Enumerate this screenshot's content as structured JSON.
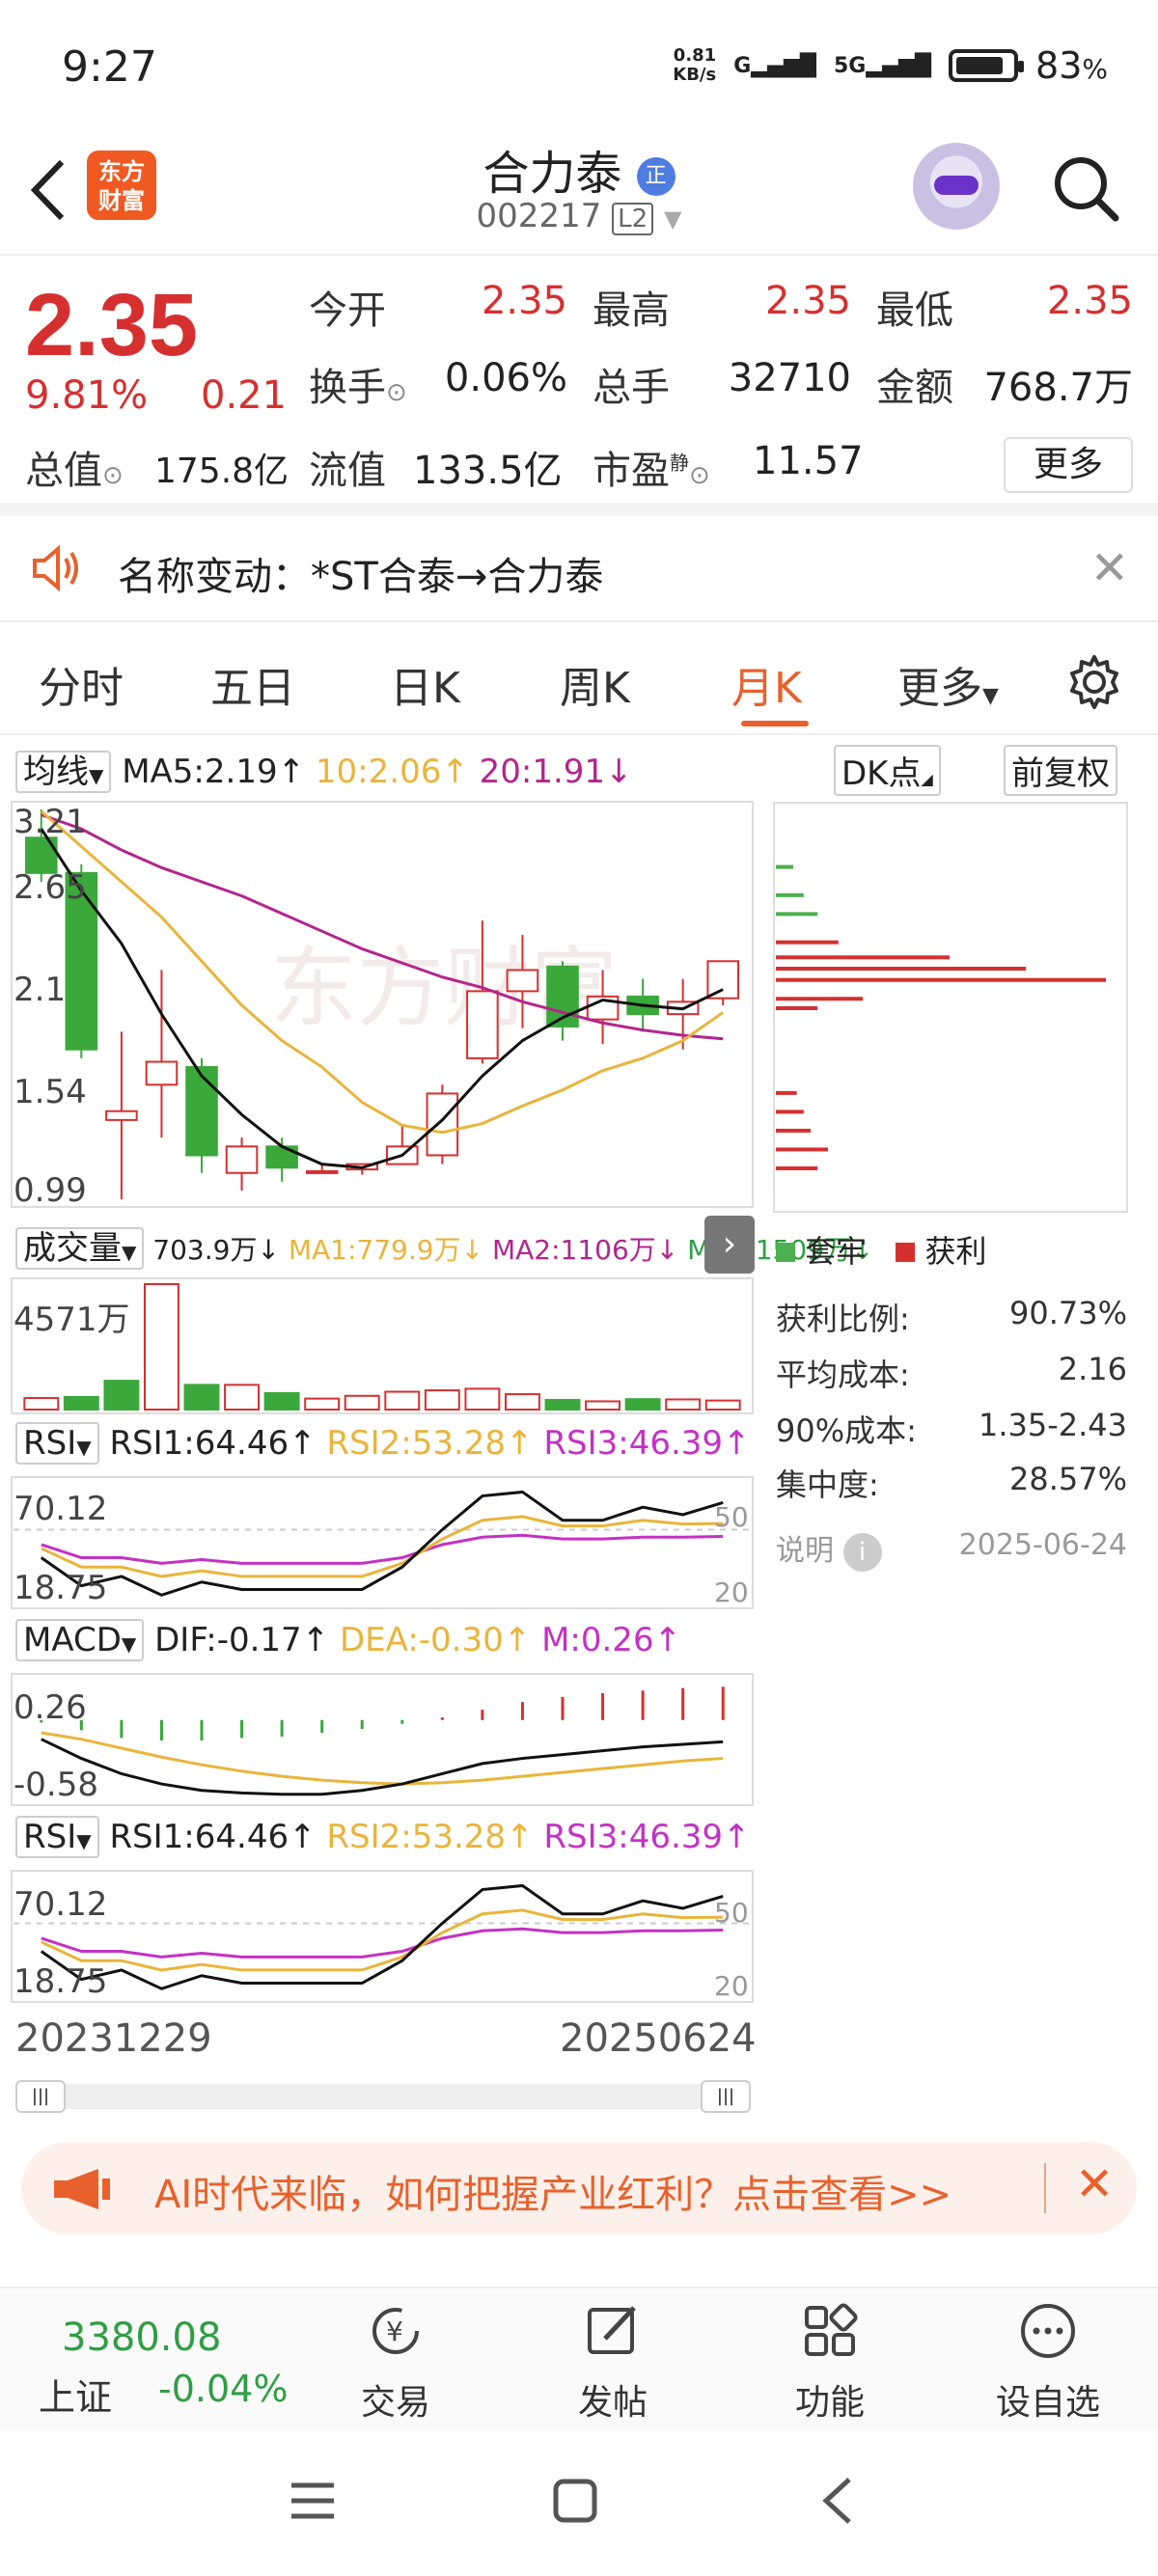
{
  "status": {
    "time": "9:27",
    "netspeed": "0.81\nKB/s",
    "signal_g": "G",
    "signal_5g": "5G",
    "battery": "83",
    "battery_unit": "%",
    "battery_level": 0.83
  },
  "header": {
    "back_icon": "chevron-left-icon",
    "logo_line1": "东方",
    "logo_line2": "财富",
    "stock_name": "合力泰",
    "name_tag": "正",
    "stock_code": "002217",
    "l2_tag": "L2"
  },
  "quote": {
    "price": "2.35",
    "pct_change": "9.81%",
    "change": "0.21",
    "open_label": "今开",
    "open": "2.35",
    "high_label": "最高",
    "high": "2.35",
    "low_label": "最低",
    "low": "2.35",
    "turnover_label": "换手",
    "turnover": "0.06%",
    "volume_label": "总手",
    "volume": "32710",
    "amount_label": "金额",
    "amount": "768.7万",
    "mktcap_label": "总值",
    "mktcap": "175.8亿",
    "float_label": "流值",
    "float": "133.5亿",
    "pe_label": "市盈",
    "pe_sup": "静",
    "pe": "11.57",
    "more": "更多"
  },
  "notice": {
    "text": "名称变动：*ST合泰→合力泰"
  },
  "tabs": [
    "分时",
    "五日",
    "日K",
    "周K",
    "月K",
    "更多"
  ],
  "active_tab": 4,
  "ma_row": {
    "selector": "均线",
    "ma5": "MA5:2.19",
    "ma10": "10:2.06",
    "ma20": "20:1.91",
    "dk": "DK点",
    "adjust": "前复权"
  },
  "vol_row": {
    "selector": "成交量",
    "v": "703.9万",
    "ma1": "MA1:779.9万",
    "ma2": "MA2:1106万",
    "ma3": "MA3:1509万",
    "max_label": "4571万"
  },
  "rsi_row": {
    "selector": "RSI",
    "rsi1": "RSI1:64.46",
    "rsi2": "RSI2:53.28",
    "rsi3": "RSI3:46.39",
    "top": "70.12",
    "bottom": "18.75",
    "r50": "50",
    "r20": "20"
  },
  "macd_row": {
    "selector": "MACD",
    "dif": "DIF:-0.17",
    "dea": "DEA:-0.30",
    "m": "M:0.26",
    "top": "0.26",
    "bottom": "-0.58"
  },
  "dates": {
    "start": "20231229",
    "end": "20250624"
  },
  "chips": {
    "legend_trap": "套牢",
    "legend_profit": "获利",
    "rows": [
      {
        "label": "获利比例:",
        "value": "90.73%"
      },
      {
        "label": "平均成本:",
        "value": "2.16"
      },
      {
        "label": "90%成本:",
        "value": "1.35-2.43"
      },
      {
        "label": "集中度:",
        "value": "28.57%"
      }
    ],
    "note_label": "说明",
    "note_date": "2025-06-24"
  },
  "banner": {
    "text": "AI时代来临，如何把握产业红利？点击查看>>"
  },
  "bottom": {
    "index_value": "3380.08",
    "index_name": "上证",
    "index_change": "-0.04%",
    "items": [
      "交易",
      "发帖",
      "功能",
      "设自选"
    ]
  },
  "chart_data": {
    "type": "candlestick",
    "title": "合力泰 月K",
    "y_ticks": [
      3.21,
      2.65,
      2.1,
      1.54,
      0.99
    ],
    "ylim": [
      0.99,
      3.21
    ],
    "candles": [
      {
        "o": 3.05,
        "c": 2.85,
        "h": 3.21,
        "l": 2.8
      },
      {
        "o": 2.85,
        "c": 1.85,
        "h": 2.9,
        "l": 1.8
      },
      {
        "o": 1.45,
        "c": 1.5,
        "h": 1.95,
        "l": 1.0
      },
      {
        "o": 1.65,
        "c": 1.78,
        "h": 2.3,
        "l": 1.35
      },
      {
        "o": 1.75,
        "c": 1.25,
        "h": 1.8,
        "l": 1.15
      },
      {
        "o": 1.15,
        "c": 1.3,
        "h": 1.35,
        "l": 1.05
      },
      {
        "o": 1.3,
        "c": 1.18,
        "h": 1.35,
        "l": 1.1
      },
      {
        "o": 1.15,
        "c": 1.16,
        "h": 1.2,
        "l": 1.15
      },
      {
        "o": 1.17,
        "c": 1.2,
        "h": 1.2,
        "l": 1.14
      },
      {
        "o": 1.2,
        "c": 1.3,
        "h": 1.42,
        "l": 1.2
      },
      {
        "o": 1.25,
        "c": 1.6,
        "h": 1.65,
        "l": 1.2
      },
      {
        "o": 1.8,
        "c": 2.18,
        "h": 2.58,
        "l": 1.77
      },
      {
        "o": 2.18,
        "c": 2.3,
        "h": 2.5,
        "l": 1.97
      },
      {
        "o": 2.32,
        "c": 1.98,
        "h": 2.35,
        "l": 1.9
      },
      {
        "o": 2.02,
        "c": 2.15,
        "h": 2.3,
        "l": 1.88
      },
      {
        "o": 2.15,
        "c": 2.05,
        "h": 2.25,
        "l": 1.95
      },
      {
        "o": 2.05,
        "c": 2.12,
        "h": 2.25,
        "l": 1.85
      },
      {
        "o": 2.14,
        "c": 2.35,
        "h": 2.35,
        "l": 2.1
      }
    ],
    "ma5": [
      3.1,
      2.75,
      2.45,
      2.05,
      1.7,
      1.48,
      1.3,
      1.2,
      1.18,
      1.25,
      1.45,
      1.7,
      1.9,
      2.03,
      2.13,
      2.1,
      2.08,
      2.19
    ],
    "ma10": [
      3.2,
      3.0,
      2.8,
      2.6,
      2.35,
      2.1,
      1.9,
      1.75,
      1.55,
      1.42,
      1.38,
      1.43,
      1.53,
      1.62,
      1.73,
      1.8,
      1.9,
      2.06
    ],
    "ma20": [
      3.18,
      3.1,
      2.98,
      2.88,
      2.8,
      2.72,
      2.62,
      2.52,
      2.42,
      2.34,
      2.26,
      2.2,
      2.12,
      2.06,
      2.0,
      1.96,
      1.93,
      1.91
    ],
    "volume": [
      420,
      460,
      1050,
      4571,
      900,
      900,
      600,
      400,
      500,
      650,
      700,
      760,
      560,
      350,
      300,
      380,
      370,
      330
    ],
    "volume_up": [
      true,
      false,
      false,
      true,
      false,
      true,
      false,
      true,
      true,
      true,
      true,
      true,
      true,
      false,
      true,
      false,
      true,
      true
    ],
    "rsi1": [
      35,
      20,
      25,
      15,
      22,
      18,
      18,
      18,
      18,
      30,
      50,
      68,
      70.12,
      55,
      55,
      62,
      58,
      64.46
    ],
    "rsi2": [
      40,
      30,
      30,
      25,
      28,
      25,
      25,
      25,
      25,
      32,
      45,
      55,
      57,
      52,
      52,
      55,
      53,
      53.28
    ],
    "rsi3": [
      42,
      35,
      35,
      32,
      34,
      32,
      32,
      32,
      32,
      35,
      42,
      46,
      47,
      45,
      45,
      46,
      46,
      46.39
    ],
    "macd_m": [
      -0.02,
      -0.08,
      -0.14,
      -0.16,
      -0.16,
      -0.14,
      -0.13,
      -0.1,
      -0.07,
      -0.03,
      0.02,
      0.08,
      0.14,
      0.18,
      0.21,
      0.23,
      0.25,
      0.26
    ],
    "dif": [
      -0.15,
      -0.3,
      -0.42,
      -0.5,
      -0.55,
      -0.57,
      -0.58,
      -0.58,
      -0.55,
      -0.5,
      -0.42,
      -0.34,
      -0.3,
      -0.27,
      -0.24,
      -0.21,
      -0.19,
      -0.17
    ],
    "dea": [
      -0.1,
      -0.15,
      -0.22,
      -0.29,
      -0.35,
      -0.4,
      -0.44,
      -0.47,
      -0.49,
      -0.5,
      -0.49,
      -0.47,
      -0.44,
      -0.41,
      -0.38,
      -0.35,
      -0.32,
      -0.3
    ],
    "chips": [
      {
        "price": 2.7,
        "w": 0.05,
        "type": "trap"
      },
      {
        "price": 2.55,
        "w": 0.08,
        "type": "trap"
      },
      {
        "price": 2.45,
        "w": 0.12,
        "type": "trap"
      },
      {
        "price": 2.3,
        "w": 0.18,
        "type": "profit"
      },
      {
        "price": 2.22,
        "w": 0.5,
        "type": "profit"
      },
      {
        "price": 2.16,
        "w": 0.72,
        "type": "profit"
      },
      {
        "price": 2.1,
        "w": 0.95,
        "type": "profit"
      },
      {
        "price": 2.0,
        "w": 0.25,
        "type": "profit"
      },
      {
        "price": 1.95,
        "w": 0.12,
        "type": "profit"
      },
      {
        "price": 1.5,
        "w": 0.06,
        "type": "profit"
      },
      {
        "price": 1.4,
        "w": 0.08,
        "type": "profit"
      },
      {
        "price": 1.3,
        "w": 0.1,
        "type": "profit"
      },
      {
        "price": 1.2,
        "w": 0.15,
        "type": "profit"
      },
      {
        "price": 1.1,
        "w": 0.12,
        "type": "profit"
      }
    ]
  }
}
